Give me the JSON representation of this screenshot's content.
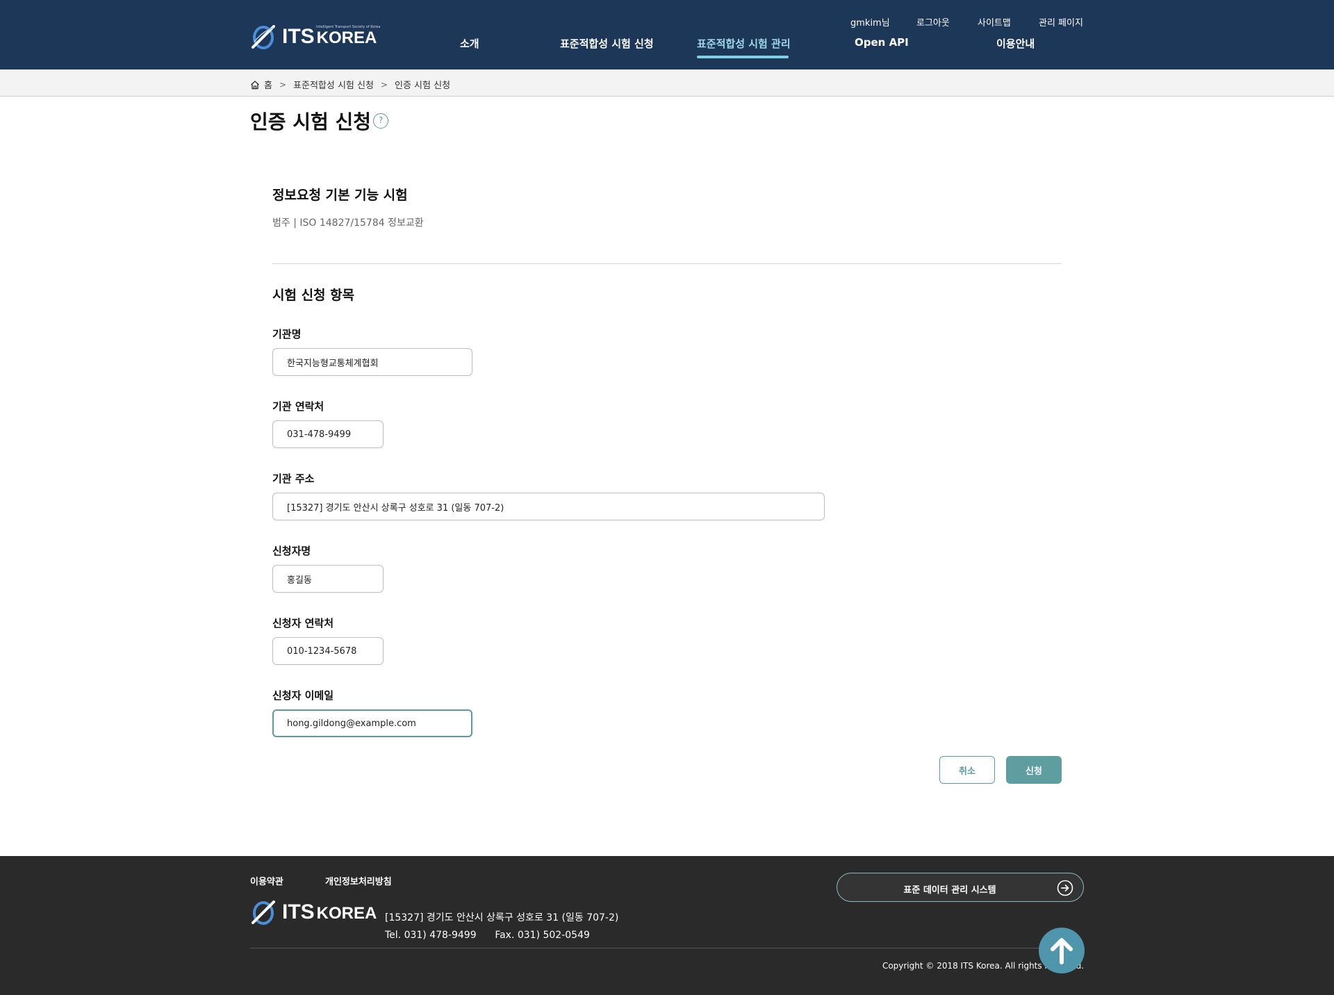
{
  "header": {
    "logo": {
      "main": "ITS",
      "sub": "KOREA",
      "tagline": "Intelligent Transport Society of Korea"
    },
    "util": {
      "user": "gmkim님",
      "logout": "로그아웃",
      "sitemap": "사이트맵",
      "admin": "관리 페이지"
    },
    "nav": [
      "소개",
      "표준적합성 시험 신청",
      "표준적합성 시험 관리",
      "Open API",
      "이용안내"
    ],
    "active_nav": "표준적합성 시험 관리"
  },
  "breadcrumb": {
    "home": "홈",
    "level1": "표준적합성 시험 신청",
    "level2": "인증 시험 신청"
  },
  "page": {
    "title": "인증 시험 신청",
    "help": "?"
  },
  "test": {
    "title": "정보요청 기본 기능 시험",
    "category": "범주 | ISO 14827/15784 정보교환"
  },
  "form": {
    "section_title": "시험 신청 항목",
    "org_name": {
      "label": "기관명",
      "value": "한국지능형교통체계협회"
    },
    "org_contact": {
      "label": "기관 연락처",
      "value": "031-478-9499"
    },
    "org_address": {
      "label": "기관 주소",
      "value": "[15327] 경기도 안산시 상록구 성호로 31 (일동 707-2)"
    },
    "applicant_name": {
      "label": "신청자명",
      "value": "홍길동"
    },
    "applicant_contact": {
      "label": "신청자 연락처",
      "value": "010-1234-5678"
    },
    "applicant_email": {
      "label": "신청자 이메일",
      "value": "hong.gildong@example.com"
    },
    "cancel_label": "취소",
    "submit_label": "신청"
  },
  "footer": {
    "terms": "이용약관",
    "privacy": "개인정보처리방침",
    "address": "[15327] 경기도 안산시 상록구 성호로 31 (일동 707-2)",
    "tel": "Tel. 031) 478-9499",
    "fax": "Fax. 031) 502-0549",
    "copyright": "Copyright © 2018 ITS Korea. All rights reserved.",
    "system_button": "표준 데이터 관리 시스템"
  },
  "colors": {
    "header_bg": "#1d3759",
    "accent": "#5f9ea0",
    "active_nav": "#9ed8ea",
    "footer_bg": "#2a2a2a",
    "top_button": "#4f95ab"
  },
  "icons": [
    "logo-mark-icon",
    "home-icon",
    "chevron-right-icon",
    "help-icon",
    "arrow-right-circle-icon",
    "arrow-up-icon"
  ]
}
